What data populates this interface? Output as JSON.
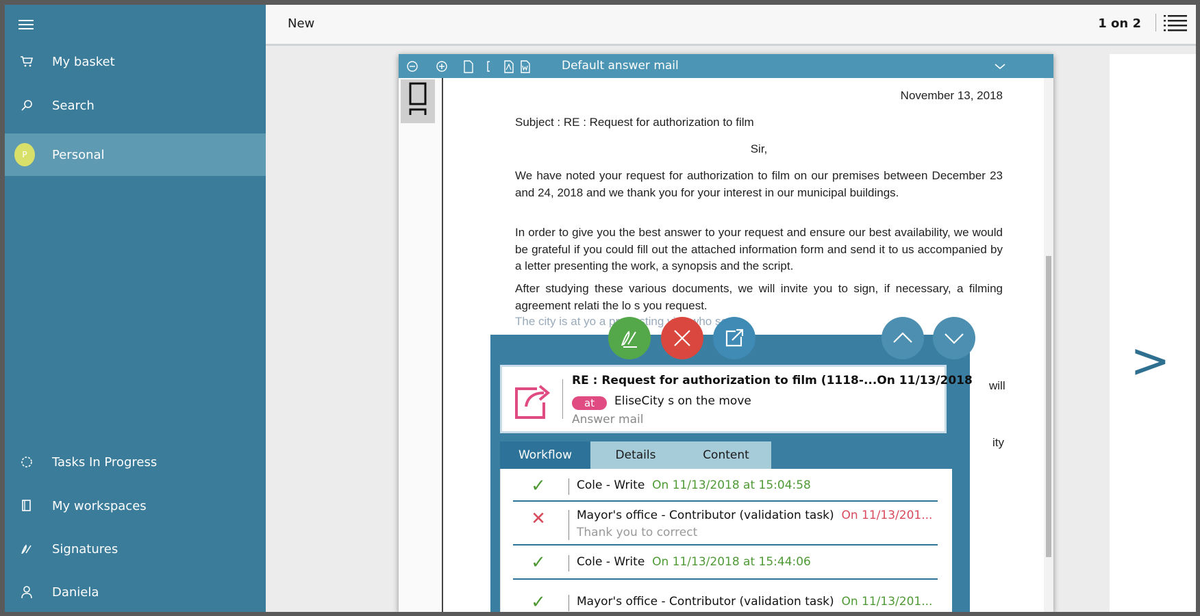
{
  "sidebar": {
    "menu_icon": "hamburger-icon",
    "items": [
      {
        "label": "My basket",
        "icon": "basket-icon"
      },
      {
        "label": "Search",
        "icon": "search-icon"
      },
      {
        "label": "Personal",
        "icon": "avatar",
        "avatar_letter": "P",
        "active": true
      },
      {
        "label": "Tasks In Progress",
        "icon": "spinner-icon"
      },
      {
        "label": "My workspaces",
        "icon": "workspace-icon"
      },
      {
        "label": "Signatures",
        "icon": "signature-icon"
      },
      {
        "label": "Daniela",
        "icon": "user-icon"
      }
    ]
  },
  "topbar": {
    "title": "New",
    "pager": "1 on 2",
    "list_icon": "list-view-icon"
  },
  "document": {
    "toolbar_title": "Default answer mail",
    "date": "November 13, 2018",
    "subject": "Subject : RE : Request for authorization to film",
    "salutation": "Sir,",
    "paragraph1": "We have noted your request for authorization to film on our premises between December 23 and 24, 2018 and we thank you for your interest in our municipal buildings.",
    "paragraph2": "In order to give you the best answer to your request and ensure our best availability, we would be grateful if you could fill out the attached information form and send it to us accompanied by a letter presenting the work, a synopsis and the script.",
    "paragraph3": "After studying these various documents, we will invite you to sign, if necessary, a filming agreement relati    the       lo       s you request.",
    "paragraph4": "The city is at yo                                                   a pre-testing visit who          so",
    "fragment_will": "will",
    "fragment_city": "ity"
  },
  "task": {
    "subject": "RE : Request for authorization to film (1118-...On 11/13/2018",
    "tag": "at",
    "from": "EliseCity s on the move",
    "kind": "Answer mail",
    "tabs": [
      "Workflow",
      "Details",
      "Content"
    ],
    "active_tab": "Workflow",
    "workflow": [
      {
        "status": "done",
        "who": "Cole - Write",
        "when": "On 11/13/2018 at 15:04:58",
        "note": ""
      },
      {
        "status": "rejected",
        "who": "Mayor's office - Contributor (validation task)",
        "when": "On 11/13/201...",
        "note": "Thank you to correct"
      },
      {
        "status": "done",
        "who": "Cole - Write",
        "when": "On 11/13/2018 at 15:44:06",
        "note": ""
      },
      {
        "status": "done",
        "who": "Mayor's office - Contributor (validation task)",
        "when": "On 11/13/201...",
        "note": ""
      }
    ]
  },
  "colors": {
    "sidebar": "#3a7c99",
    "accent": "#4d95b4",
    "approve": "#55a84a",
    "reject": "#d9473e",
    "tag": "#e04b82"
  }
}
